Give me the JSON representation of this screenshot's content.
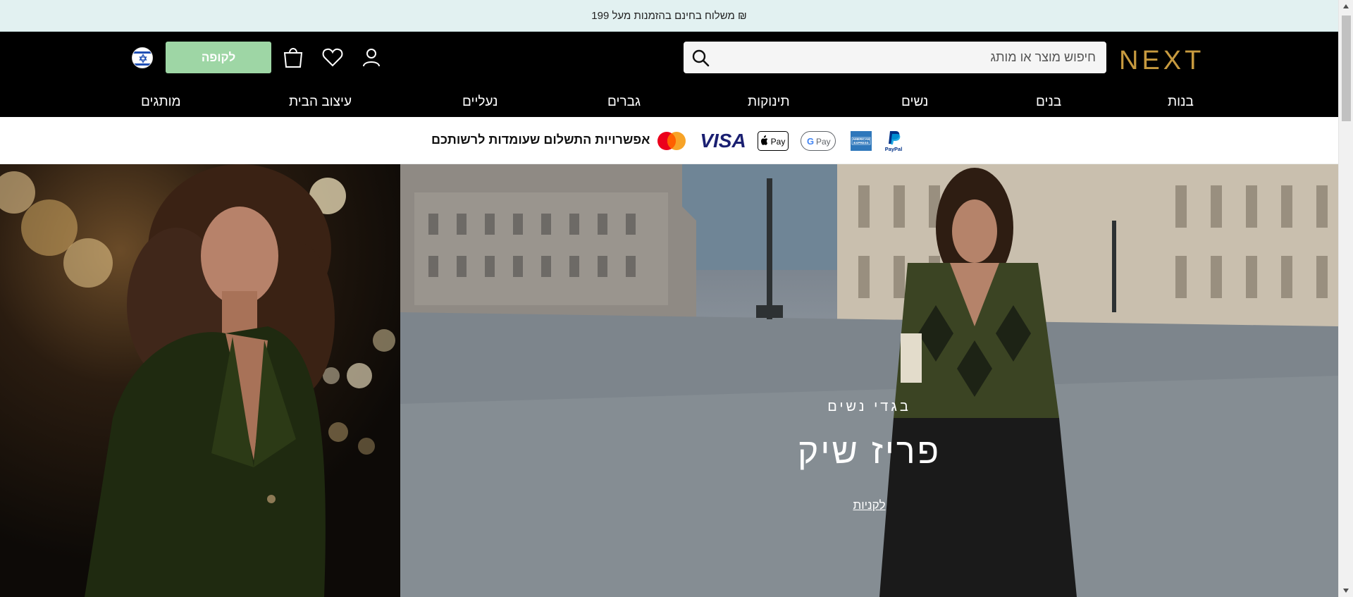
{
  "promo": {
    "text": "משלוח בחינם בהזמנות מעל 199 ₪"
  },
  "header": {
    "logo": "NEXT",
    "search_placeholder": "חיפוש מוצר או מותג",
    "checkout_label": "לקופה",
    "icons": [
      "account-icon",
      "wishlist-icon",
      "bag-icon",
      "search-icon",
      "israel-flag-icon"
    ]
  },
  "nav": {
    "items": [
      "בנות",
      "בנים",
      "נשים",
      "תינוקות",
      "גברים",
      "נעליים",
      "עיצוב הבית",
      "מותגים"
    ]
  },
  "payment": {
    "text": "אפשרויות התשלום שעומדות לרשותכם",
    "methods": [
      "PayPal",
      "American Express",
      "Google Pay",
      "Apple Pay",
      "VISA",
      "Mastercard"
    ]
  },
  "hero": {
    "subtitle": "בגדי נשים",
    "title": "פריז שיק",
    "cta": "לקניות"
  },
  "colors": {
    "header_bg": "#000000",
    "promo_bg": "#e2f1f1",
    "logo": "#c79a3f",
    "checkout_bg": "#9ed6a5"
  }
}
